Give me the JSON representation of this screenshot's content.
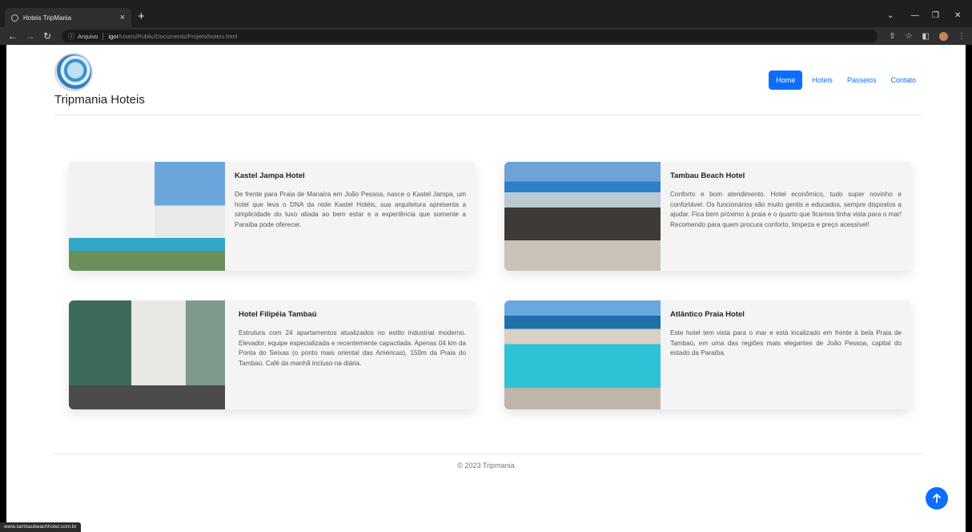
{
  "browser": {
    "tab_title": "Hoteis TripMania",
    "tab_close": "×",
    "new_tab": "+",
    "address_info": "Arquivo",
    "address_host": "igor",
    "address_path": "/Users/Public/Documents/Projeto/hoteis.html",
    "status_url": "www.tambaubeachhotel.com.br"
  },
  "header": {
    "brand": "Tripmania Hoteis",
    "nav": [
      {
        "label": "Home",
        "active": true
      },
      {
        "label": "Hoteis",
        "active": false
      },
      {
        "label": "Passeios",
        "active": false
      },
      {
        "label": "Contato",
        "active": false
      }
    ]
  },
  "hotels": [
    {
      "name": "Kastel Jampa Hotel",
      "description": "De frente para Praia de Manaíra em João Pessoa, nasce o Kastel Jampa, um hotel que leva o DNA da rede Kastel Hotéis, sua arquitetura apresenta a simplicidade do luxo aliada ao bem estar e a experiência que somente a Paraíba pode oferecer."
    },
    {
      "name": "Tambau Beach Hotel",
      "description": "Conforto e bom atendimento. Hotel econômico, tudo super novinho e confortável. Os funcionários são muito gentis e educados, sempre dispostos a ajudar. Fica bem próximo à praia e o quarto que ficamos tinha vista para o mar! Recomendo para quem procura conforto, limpeza e preço acessível!"
    },
    {
      "name": "Hotel Filipéia Tambaú",
      "description": "Estrutura com 24 apartamentos atualizados no estilo industrial moderno. Elevador, equipe especializada e recentemente capacitada. Apenas 04 km da Ponta do Seixas (o ponto mais oriental das Américas), 150m da Praia do Tambaú. Café da manhã incluso na diária."
    },
    {
      "name": "Atlântico Praia Hotel",
      "description": "Este hotel tem vista para o mar e está localizado em frente à bela Praia de Tambaú, em uma das regiões mais elegantes de João Pessoa, capital do estado da Paraíba."
    }
  ],
  "footer": {
    "copyright": "© 2023 Tripmania"
  },
  "colors": {
    "primary": "#0d6efd",
    "card_bg": "#f4f4f4"
  }
}
